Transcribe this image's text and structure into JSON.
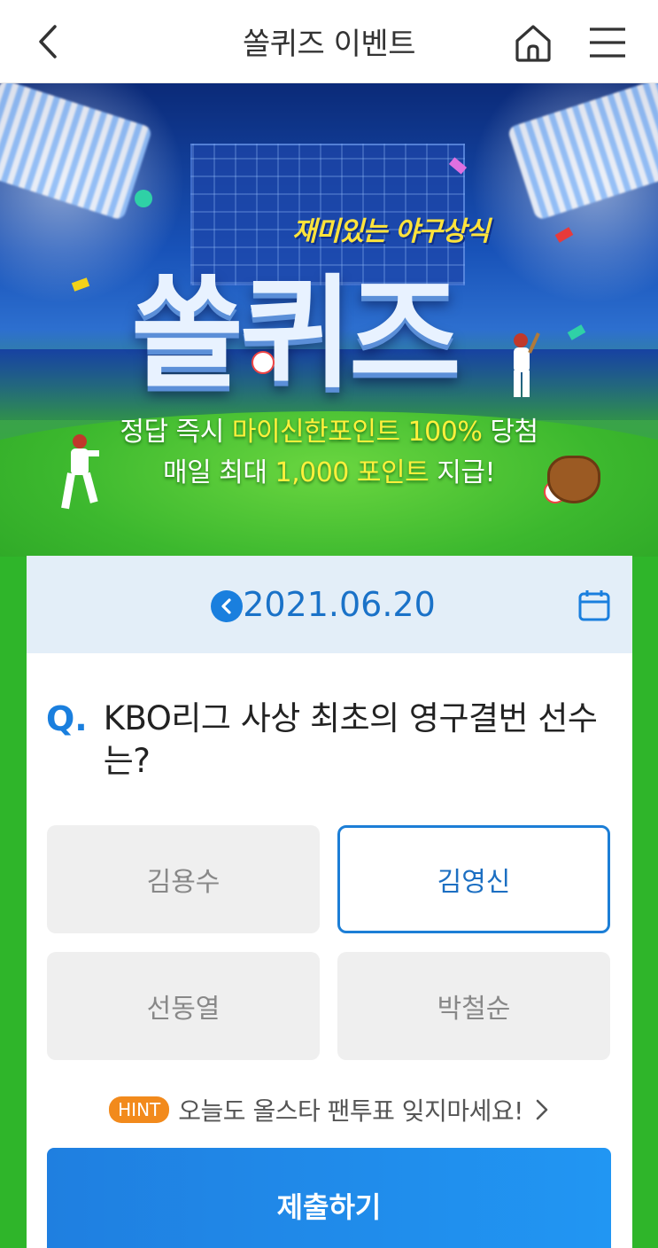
{
  "header": {
    "title": "쏠퀴즈 이벤트",
    "icons": [
      "back-icon",
      "home-icon",
      "menu-icon"
    ]
  },
  "banner": {
    "subtitle": "재미있는 야구상식",
    "title": "쏠퀴즈",
    "promo_line1_pre": "정답 즉시 ",
    "promo_line1_hl": "마이신한포인트 100%",
    "promo_line1_post": " 당첨",
    "promo_line2_pre": "매일 최대 ",
    "promo_line2_hl": "1,000 포인트",
    "promo_line2_post": " 지급!"
  },
  "quiz": {
    "date": "2021.06.20",
    "question_prefix": "Q.",
    "question": "KBO리그 사상 최초의 영구결번 선수는?",
    "options": [
      {
        "label": "김용수",
        "selected": false
      },
      {
        "label": "김영신",
        "selected": true
      },
      {
        "label": "선동열",
        "selected": false
      },
      {
        "label": "박철순",
        "selected": false
      }
    ],
    "hint_badge": "HINT",
    "hint_text": "오늘도 올스타 팬투표 잊지마세요!",
    "submit_label": "제출하기"
  },
  "colors": {
    "accent": "#1a7fde",
    "hint_badge": "#f28a1c",
    "highlight": "#fff03c",
    "field": "#2fb52a"
  }
}
